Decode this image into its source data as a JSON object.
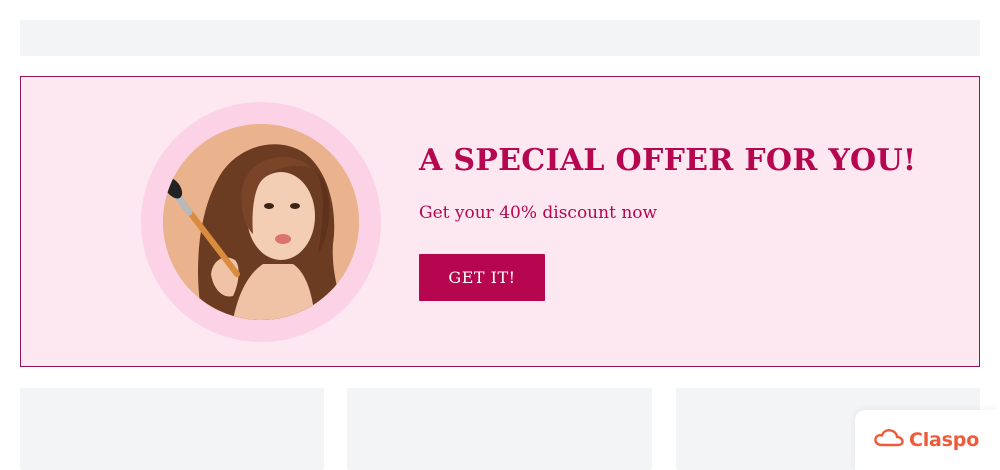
{
  "offer": {
    "title": "A SPECIAL OFFER FOR YOU!",
    "subtitle": "Get your 40% discount now",
    "cta_label": "GET IT!"
  },
  "brand": {
    "name": "Claspo",
    "icon": "cloud-icon"
  },
  "colors": {
    "accent": "#b5064f",
    "banner_bg": "#fde8f1",
    "ring": "#fcd3e6",
    "placeholder": "#f3f4f5",
    "brand": "#ee5a3a"
  }
}
